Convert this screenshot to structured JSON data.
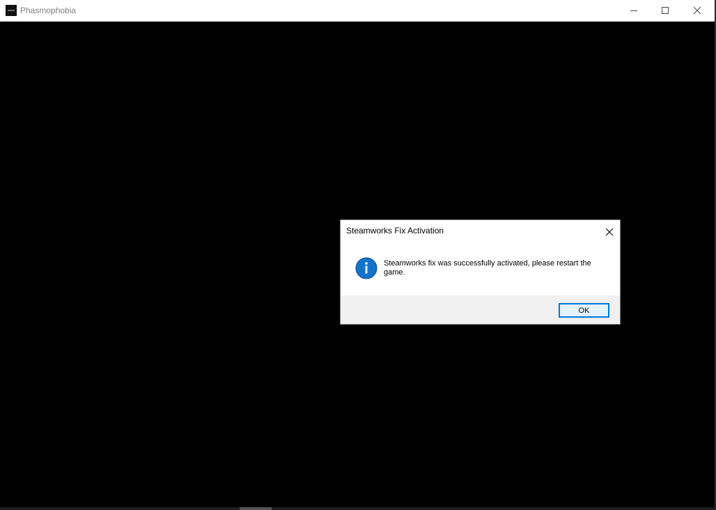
{
  "window": {
    "title": "Phasmophobia",
    "icon": "phasmophobia-app-icon",
    "controls": {
      "minimize_icon": "minimize-icon",
      "maximize_icon": "maximize-icon",
      "close_icon": "close-icon"
    },
    "background": "#000000"
  },
  "dialog": {
    "title": "Steamworks Fix Activation",
    "icon": "info-icon",
    "icon_color": "#1473c9",
    "message": "Steamworks fix was successfully activated, please restart the game.",
    "ok_label": "OK",
    "accent_color": "#0078d7"
  }
}
